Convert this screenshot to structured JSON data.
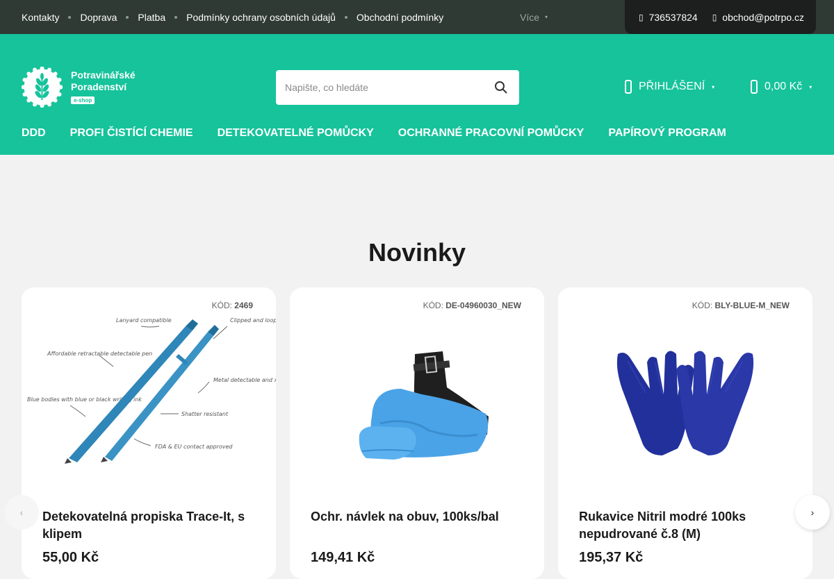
{
  "topbar": {
    "links": [
      "Kontakty",
      "Doprava",
      "Platba",
      "Podmínky ochrany osobních údajů",
      "Obchodní podmínky"
    ],
    "more_label": "Více",
    "phone": "736537824",
    "email": "obchod@potrpo.cz"
  },
  "header": {
    "logo_line1": "Potravinářské",
    "logo_line2": "Poradenství",
    "logo_badge": "e-shop",
    "search_placeholder": "Napište, co hledáte",
    "login_label": "PŘIHLÁŠENÍ",
    "cart_total": "0,00 Kč",
    "nav": [
      "DDD",
      "PROFI ČISTÍCÍ CHEMIE",
      "DETEKOVATELNÉ POMŮCKY",
      "OCHRANNÉ PRACOVNÍ POMŮCKY",
      "PAPÍROVÝ PROGRAM"
    ]
  },
  "section": {
    "title": "Novinky"
  },
  "code_label": "KÓD:",
  "products": [
    {
      "code": "2469",
      "name": "Detekovatelná propiska Trace-It, s klipem",
      "price": "55,00 Kč",
      "annotations": [
        "Lanyard compatible",
        "Clipped and looped versions available",
        "Affordable retractable detectable pen",
        "Metal detectable and x-ray visible parts",
        "Blue bodies with blue or black writing ink",
        "Shatter resistant",
        "FDA & EU contact approved"
      ]
    },
    {
      "code": "DE-04960030_NEW",
      "name": "Ochr. návlek na obuv, 100ks/bal",
      "price": "149,41 Kč"
    },
    {
      "code": "BLY-BLUE-M_NEW",
      "name": "Rukavice Nitril modré 100ks nepudrované č.8 (M)",
      "price": "195,37 Kč"
    }
  ],
  "colors": {
    "brand_green": "#16c39b",
    "topbar_bg": "#2f3a34",
    "contact_bg": "#1c1f1e",
    "page_bg": "#f2f2f2",
    "pen_blue": "#2f86b8",
    "cover_blue": "#4aa3e6",
    "glove_blue": "#22309b"
  }
}
